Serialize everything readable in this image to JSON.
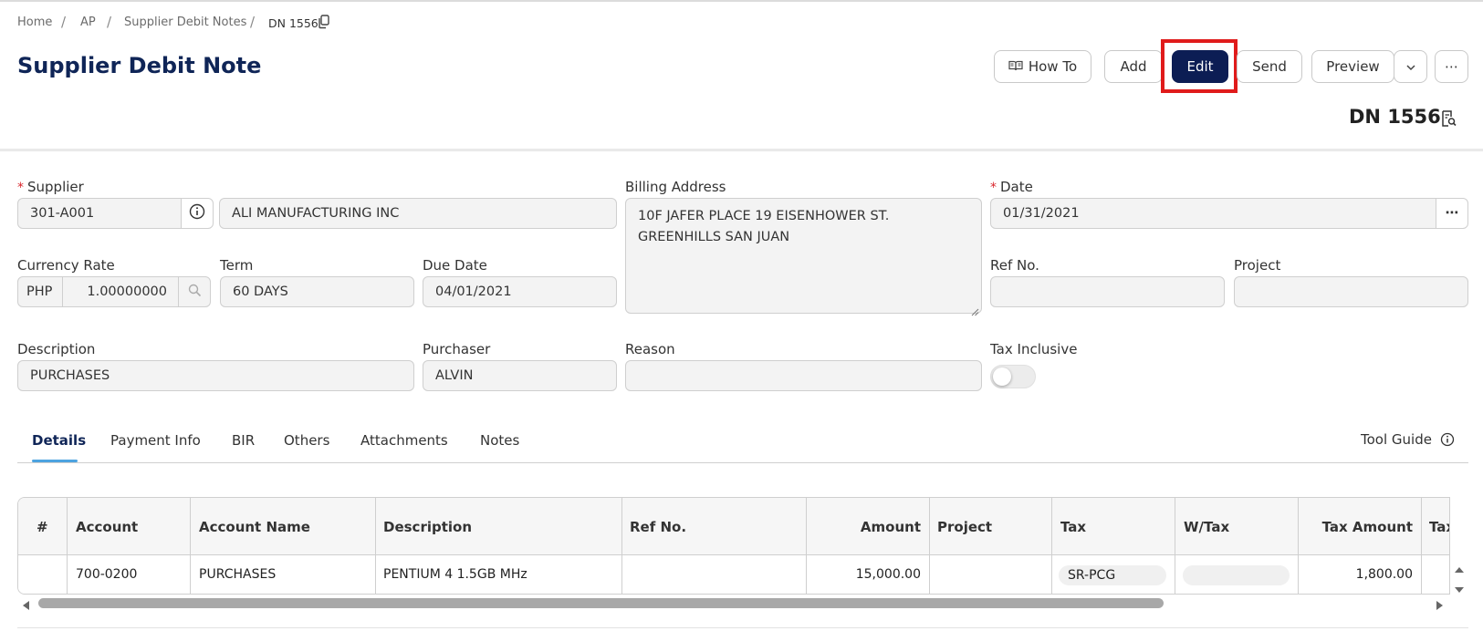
{
  "breadcrumb": {
    "items": [
      "Home",
      "AP",
      "Supplier Debit Notes"
    ],
    "current": "DN 1556",
    "separator": "/"
  },
  "page": {
    "title": "Supplier Debit Note",
    "doc_number": "DN 1556"
  },
  "toolbar": {
    "how_to": "How To",
    "add": "Add",
    "edit": "Edit",
    "send": "Send",
    "preview": "Preview",
    "more": "⋯"
  },
  "form": {
    "supplier": {
      "label": "Supplier",
      "code": "301-A001",
      "name": "ALI MANUFACTURING INC"
    },
    "billing_address": {
      "label": "Billing Address",
      "line1": "10F JAFER PLACE 19 EISENHOWER ST.",
      "line2": "GREENHILLS SAN JUAN"
    },
    "date": {
      "label": "Date",
      "value": "01/31/2021",
      "more": "⋯"
    },
    "currency_rate": {
      "label": "Currency Rate",
      "currency": "PHP",
      "rate": "1.00000000"
    },
    "term": {
      "label": "Term",
      "value": "60 DAYS"
    },
    "due_date": {
      "label": "Due Date",
      "value": "04/01/2021"
    },
    "ref_no": {
      "label": "Ref No.",
      "value": ""
    },
    "project": {
      "label": "Project",
      "value": ""
    },
    "description": {
      "label": "Description",
      "value": "PURCHASES"
    },
    "purchaser": {
      "label": "Purchaser",
      "value": "ALVIN"
    },
    "reason": {
      "label": "Reason",
      "value": ""
    },
    "tax_inclusive": {
      "label": "Tax Inclusive",
      "on": false
    }
  },
  "tabs": [
    "Details",
    "Payment Info",
    "BIR",
    "Others",
    "Attachments",
    "Notes"
  ],
  "active_tab": "Details",
  "tool_guide": "Tool Guide",
  "grid": {
    "columns": [
      "#",
      "Account",
      "Account Name",
      "Description",
      "Ref No.",
      "Amount",
      "Project",
      "Tax",
      "W/Tax",
      "Tax Amount",
      "Tax"
    ],
    "rows": [
      {
        "num": "",
        "account": "700-0200",
        "account_name": "PURCHASES",
        "description": "PENTIUM 4 1.5GB MHz",
        "ref_no": "",
        "amount": "15,000.00",
        "project": "",
        "tax": "SR-PCG",
        "w_tax": "",
        "tax_amount": "1,800.00"
      }
    ]
  },
  "colors": {
    "primary": "#0c1d54",
    "title": "#0f2557",
    "highlight": "#e01b1b",
    "tab_underline": "#4da3e0",
    "required": "#d9262c"
  }
}
